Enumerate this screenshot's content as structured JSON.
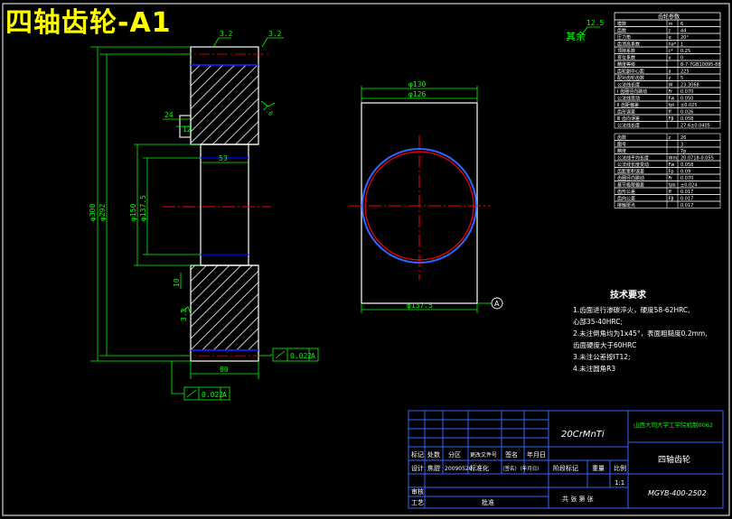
{
  "title": "四轴齿轮-A1",
  "roughness": {
    "rest_label": "其余",
    "rest_value": "12.5",
    "top_left": "3.2",
    "top_right": "3.2",
    "right_small": "1.6",
    "lower_left": "3.2"
  },
  "dims": {
    "d_outer": "φ300",
    "d_tip": "φ292",
    "d_hub": "φ150",
    "d_bore": "φ137.5",
    "d_130": "φ130",
    "d_126": "φ126",
    "d_137_5": "φ137.5",
    "w80": "80",
    "w53": "53",
    "w24": "24",
    "w12": "12",
    "w10": "10",
    "datum": "A"
  },
  "tolerances": {
    "upper": {
      "value": "0.022",
      "datum": "A"
    },
    "lower": {
      "value": "0.022",
      "datum": "A"
    }
  },
  "tech_requirements": {
    "heading": "技术要求",
    "items": [
      "1.齿面进行渗碳淬火，硬度58-62HRC,",
      "  心部35-40HRC;",
      "2.未注倒角均为1x45°，表面粗糙度0.2mm,",
      "  齿面硬度大于60HRC",
      "3.未注公差按IT12;",
      "4.未注圆角R3"
    ]
  },
  "param_table": {
    "header": "齿轮参数",
    "rows": [
      [
        "模数",
        "m",
        "6"
      ],
      [
        "齿数",
        "z",
        "44"
      ],
      [
        "压力角",
        "α",
        "20°"
      ],
      [
        "齿顶高系数",
        "ha*",
        "1"
      ],
      [
        "顶隙系数",
        "c*",
        "0.25"
      ],
      [
        "变位系数",
        "x",
        "0"
      ],
      [
        "精度等级",
        "",
        "8-7-7GB10095-88"
      ],
      [
        "齿轮副中心距",
        "a",
        "225"
      ],
      [
        "配对齿轮齿数",
        "z",
        "5"
      ],
      [
        "公法线长度",
        "W",
        "23.3068"
      ],
      [
        "Ⅰ 齿圈径向跳动",
        "Fr",
        "0.070"
      ],
      [
        "公法线变动",
        "Fw",
        "0.050"
      ],
      [
        "Ⅱ 齿距偏差",
        "fpt",
        "±0.025"
      ],
      [
        "齿形误差",
        "ff",
        "0.026"
      ],
      [
        "Ⅲ 齿向误差",
        "Fβ",
        "0.058"
      ],
      [
        "公法线长度",
        "",
        "27.6±0.0405"
      ]
    ],
    "rows2": [
      [
        "齿数",
        "z",
        "26"
      ],
      [
        "图号",
        "",
        "3"
      ],
      [
        "精度",
        "",
        "7p"
      ],
      [
        "公法线平均长度",
        "Wm",
        "20.0718-0.055"
      ],
      [
        "公法线长度变动",
        "Fw",
        "0.058"
      ],
      [
        "齿距累积误差",
        "Fp",
        "0.09"
      ],
      [
        "齿圈径向跳动",
        "Fr",
        "0.070"
      ],
      [
        "基节极限偏差",
        "fpb",
        "±0.024"
      ],
      [
        "齿形公差",
        "ff",
        "0.017"
      ],
      [
        "齿向公差",
        "Fβ",
        "0.017"
      ],
      [
        "接触斑点",
        "",
        "0.017"
      ]
    ]
  },
  "title_block": {
    "material": "20CrMnTi",
    "school": "山西大同大学工学院机制0062",
    "part_name": "四轴齿轮",
    "drawing_no": "MGYB-400-2502",
    "scale": "1:1",
    "labels": {
      "mark": "标记",
      "count": "处数",
      "zone": "分区",
      "change_doc": "更改文件号",
      "sign": "签名",
      "date": "年月日",
      "design": "设计",
      "designer": "焦甜",
      "design_date": "20090520",
      "standard": "标准化",
      "sig_date": "（签名）（年月日）",
      "stage": "阶段标记",
      "weight": "重量",
      "ratio": "比例",
      "review": "审核",
      "process": "工艺",
      "approve": "批准",
      "sheets": "共 张  第 张"
    }
  }
}
